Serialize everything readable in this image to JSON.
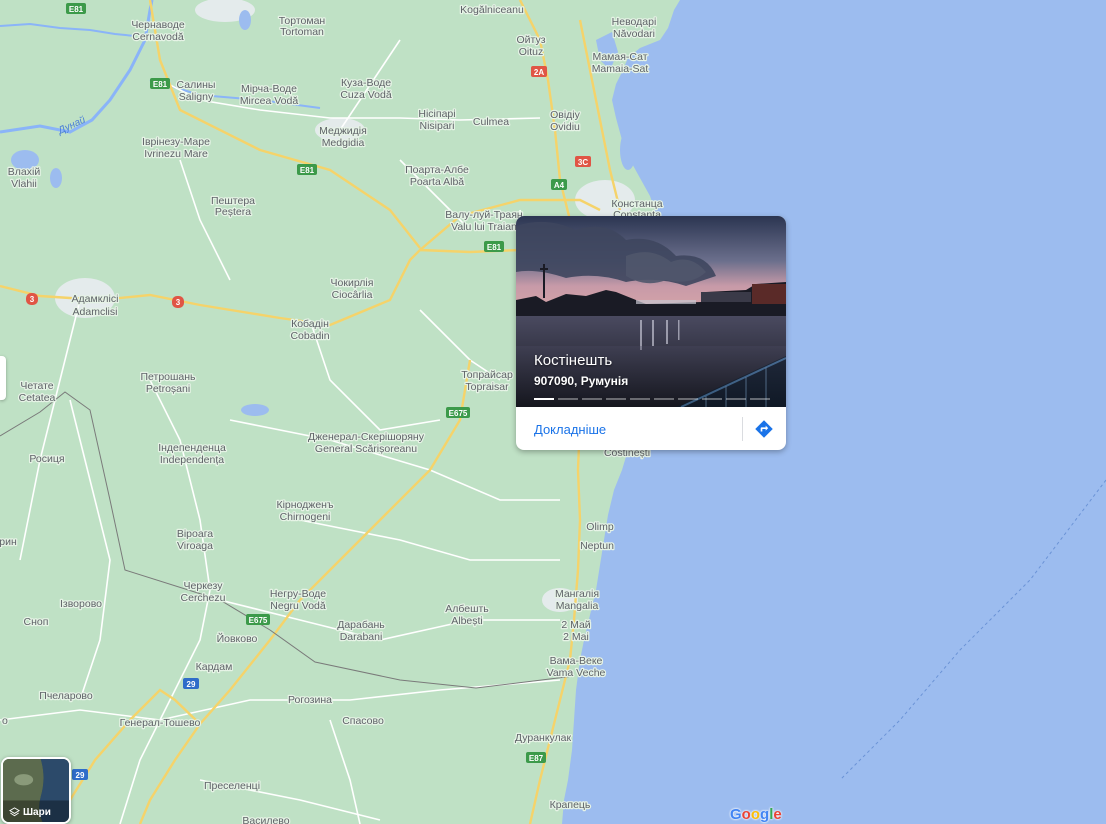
{
  "map": {
    "colors": {
      "land": "#bfe1c5",
      "sea": "#9cbcef",
      "road_major": "#f5d36a",
      "road_minor": "#ffffff",
      "river": "#8ab4f8",
      "border": "#7a7a7a"
    },
    "places": [
      {
        "id": "cernavoda",
        "ua": "Чернаводе",
        "ro": "Cernavodă"
      },
      {
        "id": "tortoman",
        "ua": "Тортоман",
        "ro": "Tortoman"
      },
      {
        "id": "kogalniceanu",
        "ua": "",
        "ro": "Kogălniceanu"
      },
      {
        "id": "navodari",
        "ua": "Неводарі",
        "ro": "Năvodari"
      },
      {
        "id": "oituz",
        "ua": "Ойтуз",
        "ro": "Oituz"
      },
      {
        "id": "mamaia",
        "ua": "Мамая-Сат",
        "ro": "Mamaia-Sat"
      },
      {
        "id": "saligny",
        "ua": "Салины",
        "ro": "Saligny"
      },
      {
        "id": "mirceavoda",
        "ua": "Мірча-Воде",
        "ro": "Mircea Vodă"
      },
      {
        "id": "cuzavoda",
        "ua": "Куза-Воде",
        "ro": "Cuza Vodă"
      },
      {
        "id": "nisipari",
        "ua": "Нісіпарі",
        "ro": "Nisipari"
      },
      {
        "id": "culmea",
        "ua": "",
        "ro": "Culmea"
      },
      {
        "id": "ovidiu",
        "ua": "Овідіу",
        "ro": "Ovidiu"
      },
      {
        "id": "medgidia",
        "ua": "Меджидія",
        "ro": "Medgidia"
      },
      {
        "id": "ivrinezu",
        "ua": "Іврінезу-Маре",
        "ro": "Ivrinezu Mare"
      },
      {
        "id": "vlahii",
        "ua": "Влахій",
        "ro": "Vlahii"
      },
      {
        "id": "poartaalba",
        "ua": "Поарта-Албе",
        "ro": "Poarta Albă"
      },
      {
        "id": "constanta",
        "ua": "Констанца",
        "ro": "Constanța"
      },
      {
        "id": "pestera",
        "ua": "Пештера",
        "ro": "Peștera"
      },
      {
        "id": "valului",
        "ua": "Валу-луй-Траян",
        "ro": "Valu lui Traian"
      },
      {
        "id": "adamclisi",
        "ua": "Адамклісі",
        "ro": "Adamclisi"
      },
      {
        "id": "ciocarlia",
        "ua": "Чокирлія",
        "ro": "Ciocârlia"
      },
      {
        "id": "cobadin",
        "ua": "Кобадін",
        "ro": "Cobadin"
      },
      {
        "id": "petrosani",
        "ua": "Петрошань",
        "ro": "Petroșani"
      },
      {
        "id": "topraisar",
        "ua": "Топрайсар",
        "ro": "Topraisar"
      },
      {
        "id": "cetatea",
        "ua": "Четате",
        "ro": "Cetatea"
      },
      {
        "id": "independenta",
        "ua": "Індепенденца",
        "ro": "Independența"
      },
      {
        "id": "scarisoreanu",
        "ua": "Дженерал-Скерішоряну",
        "ro": "General Scărișoreanu"
      },
      {
        "id": "costinesti_map",
        "ua": "",
        "ro": "Costinești"
      },
      {
        "id": "rositsa",
        "ua": "Росиця",
        "ro": ""
      },
      {
        "id": "chirnogeni",
        "ua": "Кірнодженъ",
        "ro": "Chirnogeni"
      },
      {
        "id": "olimp",
        "ua": "",
        "ro": "Olimp"
      },
      {
        "id": "neptun",
        "ua": "",
        "ro": "Neptun"
      },
      {
        "id": "viroaga",
        "ua": "Віроага",
        "ro": "Viroaga"
      },
      {
        "id": "rin",
        "ua": "рин",
        "ro": ""
      },
      {
        "id": "cerchezu",
        "ua": "Черкезу",
        "ro": "Cerchezu"
      },
      {
        "id": "negruvoda",
        "ua": "Негру-Воде",
        "ro": "Negru Vodă"
      },
      {
        "id": "albesti",
        "ua": "Албешть",
        "ro": "Albești"
      },
      {
        "id": "mangalia",
        "ua": "Мангалія",
        "ro": "Mangalia"
      },
      {
        "id": "izvorovo",
        "ua": "Ізворово",
        "ro": ""
      },
      {
        "id": "snop",
        "ua": "Сноп",
        "ro": ""
      },
      {
        "id": "darabani",
        "ua": "Дарабань",
        "ro": "Darabani"
      },
      {
        "id": "doimai",
        "ua": "2 Май",
        "ro": "2 Mai"
      },
      {
        "id": "yovkovo",
        "ua": "Йовково",
        "ro": ""
      },
      {
        "id": "kardam",
        "ua": "Кардам",
        "ro": ""
      },
      {
        "id": "vamaveche",
        "ua": "Вама-Веке",
        "ro": "Vama Veche"
      },
      {
        "id": "pchelarovo",
        "ua": "Пчеларово",
        "ro": ""
      },
      {
        "id": "rogozina",
        "ua": "Рогозина",
        "ro": ""
      },
      {
        "id": "toshevo",
        "ua": "Генерал-Тошево",
        "ro": ""
      },
      {
        "id": "spasovo",
        "ua": "Спасово",
        "ro": ""
      },
      {
        "id": "durankulak",
        "ua": "Дуранкулак",
        "ro": ""
      },
      {
        "id": "preselentsi",
        "ua": "Преселенці",
        "ro": ""
      },
      {
        "id": "krapets",
        "ua": "Крапець",
        "ro": ""
      },
      {
        "id": "vasilevo",
        "ua": "Василево",
        "ro": ""
      }
    ],
    "river_name": "Дунай",
    "shields": [
      {
        "id": "e81a",
        "text": "E81",
        "color": "#3c9a4a"
      },
      {
        "id": "e81b",
        "text": "E81",
        "color": "#3c9a4a"
      },
      {
        "id": "e81c",
        "text": "E81",
        "color": "#3c9a4a"
      },
      {
        "id": "e81d",
        "text": "E81",
        "color": "#3c9a4a"
      },
      {
        "id": "a2",
        "text": "2A",
        "color": "#e05545"
      },
      {
        "id": "a3c",
        "text": "3C",
        "color": "#e05545"
      },
      {
        "id": "a4",
        "text": "A4",
        "color": "#3c9a4a"
      },
      {
        "id": "r3a",
        "text": "3",
        "color": "#e05545"
      },
      {
        "id": "r3b",
        "text": "3",
        "color": "#e05545"
      },
      {
        "id": "e675a",
        "text": "E675",
        "color": "#3c9a4a"
      },
      {
        "id": "e675b",
        "text": "E675",
        "color": "#3c9a4a"
      },
      {
        "id": "r29a",
        "text": "29",
        "color": "#2f6dc9"
      },
      {
        "id": "r29b",
        "text": "29",
        "color": "#2f6dc9"
      },
      {
        "id": "e87",
        "text": "E87",
        "color": "#3c9a4a"
      }
    ]
  },
  "card": {
    "title": "Костінешть",
    "subtitle": "907090, Румунія",
    "more_label": "Докладніше",
    "photo_count": 10,
    "active_photo": 1,
    "directions_icon": "directions-icon"
  },
  "layers": {
    "label": "Шари",
    "icon": "layers-icon"
  },
  "google_logo": [
    "G",
    "o",
    "o",
    "g",
    "l",
    "e"
  ],
  "logo_colors": [
    "#4285f4",
    "#ea4335",
    "#fbbc05",
    "#4285f4",
    "#34a853",
    "#ea4335"
  ]
}
